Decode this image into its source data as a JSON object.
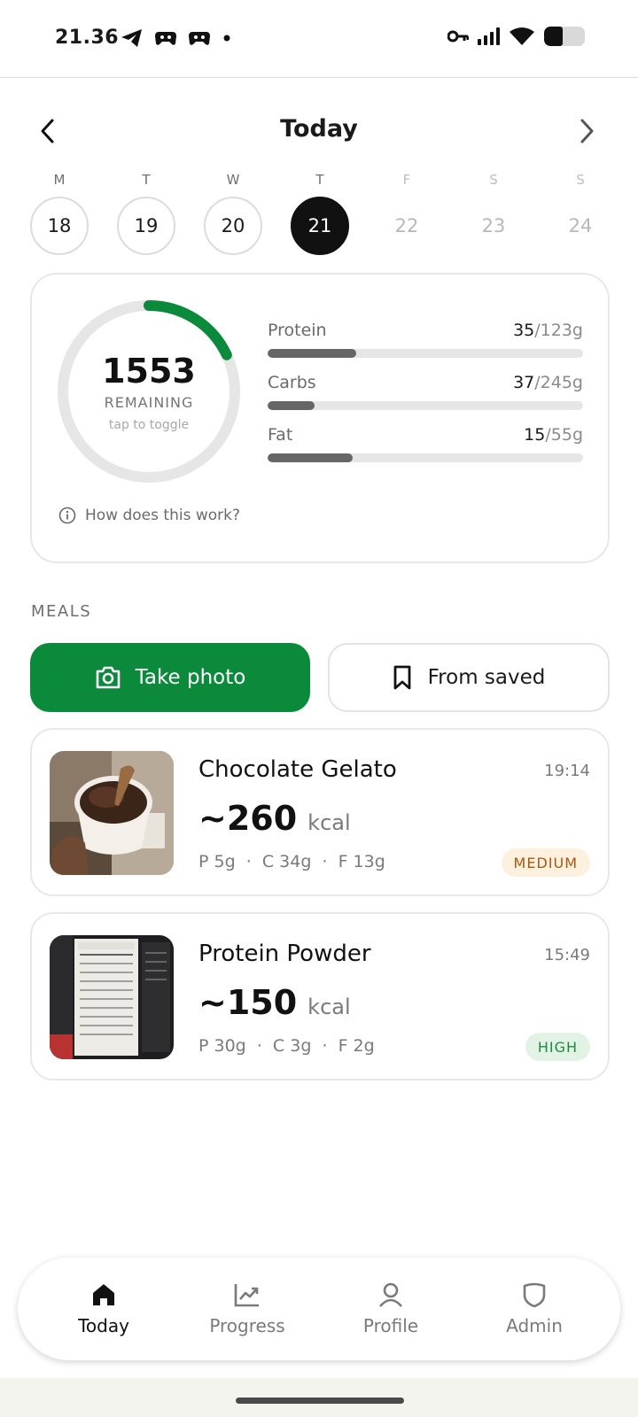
{
  "status_bar": {
    "time": "21.36",
    "left_icons": [
      "telegram-icon",
      "game-controller-icon",
      "game-controller-icon",
      "dot-icon"
    ],
    "right_icons": [
      "vpn-key-icon",
      "signal-icon",
      "wifi-icon",
      "battery-icon"
    ]
  },
  "header": {
    "title": "Today",
    "prev_icon": "chevron-left-icon",
    "next_icon": "chevron-right-icon"
  },
  "week": {
    "days": [
      {
        "letter": "M",
        "num": "18",
        "state": "past"
      },
      {
        "letter": "T",
        "num": "19",
        "state": "past"
      },
      {
        "letter": "W",
        "num": "20",
        "state": "past"
      },
      {
        "letter": "T",
        "num": "21",
        "state": "active"
      },
      {
        "letter": "F",
        "num": "22",
        "state": "future"
      },
      {
        "letter": "S",
        "num": "23",
        "state": "future"
      },
      {
        "letter": "S",
        "num": "24",
        "state": "future"
      }
    ]
  },
  "summary": {
    "remaining_value": "1553",
    "remaining_label": "REMAINING",
    "toggle_hint": "tap to toggle",
    "ring_progress": 0.18,
    "ring_color": "#0a8a3a",
    "macros": [
      {
        "name": "Protein",
        "current": "35",
        "goal": "/123g",
        "fraction": 0.28
      },
      {
        "name": "Carbs",
        "current": "37",
        "goal": "/245g",
        "fraction": 0.15
      },
      {
        "name": "Fat",
        "current": "15",
        "goal": "/55g",
        "fraction": 0.27
      }
    ],
    "how_text": "How does this work?"
  },
  "meals": {
    "section_label": "MEALS",
    "take_photo_label": "Take photo",
    "from_saved_label": "From saved",
    "items": [
      {
        "name": "Chocolate Gelato",
        "time": "19:14",
        "kcal": "~260",
        "unit": "kcal",
        "macros": "P 5g  ·  C 34g  ·  F 13g",
        "confidence": "MEDIUM"
      },
      {
        "name": "Protein Powder",
        "time": "15:49",
        "kcal": "~150",
        "unit": "kcal",
        "macros": "P 30g  ·  C 3g  ·  F 2g",
        "confidence": "HIGH"
      }
    ]
  },
  "bottom_nav": {
    "items": [
      {
        "label": "Today",
        "icon": "home-icon"
      },
      {
        "label": "Progress",
        "icon": "chart-trend-icon"
      },
      {
        "label": "Profile",
        "icon": "person-icon"
      },
      {
        "label": "Admin",
        "icon": "shield-icon"
      }
    ]
  },
  "colors": {
    "accent": "#0a8a3a",
    "badge_medium_bg": "#fdf0df",
    "badge_high_bg": "#e2f3e6"
  }
}
